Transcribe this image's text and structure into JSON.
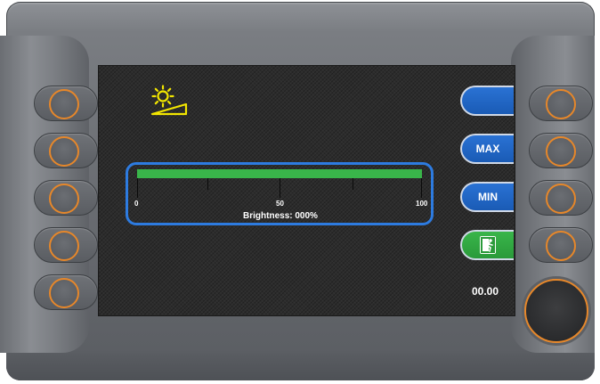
{
  "side_buttons": {
    "top_label": "",
    "max_label": "MAX",
    "min_label": "MIN",
    "exit_icon": "exit-icon"
  },
  "brightness": {
    "icon": "brightness-icon",
    "scale_min": "0",
    "scale_mid": "50",
    "scale_max": "100",
    "label": "Brightness: 000%",
    "level_percent": 0
  },
  "time_display": "00.00",
  "colors": {
    "accent_orange": "#e6872a",
    "button_blue": "#2a72d4",
    "bar_green": "#39b54a",
    "panel_border_blue": "#2d7be0",
    "icon_yellow": "#f2e600"
  }
}
